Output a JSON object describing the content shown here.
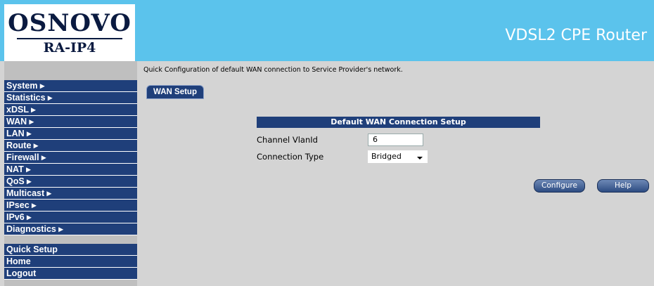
{
  "header": {
    "logo_main": "OSNOVO",
    "logo_sub": "RA-IP4",
    "product_title": "VDSL2 CPE Router"
  },
  "sidebar": {
    "items": [
      {
        "label": "System ▸"
      },
      {
        "label": "Statistics ▸"
      },
      {
        "label": "xDSL ▸"
      },
      {
        "label": "WAN ▸"
      },
      {
        "label": "LAN ▸"
      },
      {
        "label": "Route ▸"
      },
      {
        "label": "Firewall ▸"
      },
      {
        "label": "NAT ▸"
      },
      {
        "label": "QoS ▸"
      },
      {
        "label": "Multicast ▸"
      },
      {
        "label": "IPsec ▸"
      },
      {
        "label": "IPv6 ▸"
      },
      {
        "label": "Diagnostics ▸"
      }
    ],
    "bottom_items": [
      {
        "label": "Quick Setup"
      },
      {
        "label": "Home"
      },
      {
        "label": "Logout"
      }
    ]
  },
  "main": {
    "description": "Quick Configuration of default WAN connection to Service Provider's network.",
    "tab_label": "WAN Setup",
    "table_title": "Default WAN Connection Setup",
    "vlan_label": "Channel VlanId",
    "vlan_value": "6",
    "conn_type_label": "Connection Type",
    "conn_type_value": "Bridged",
    "configure_label": "Configure",
    "help_label": "Help"
  },
  "colors": {
    "header_bg": "#5bc3ec",
    "nav_bg": "#1f3f7a",
    "page_bg": "#d4d4d4"
  }
}
